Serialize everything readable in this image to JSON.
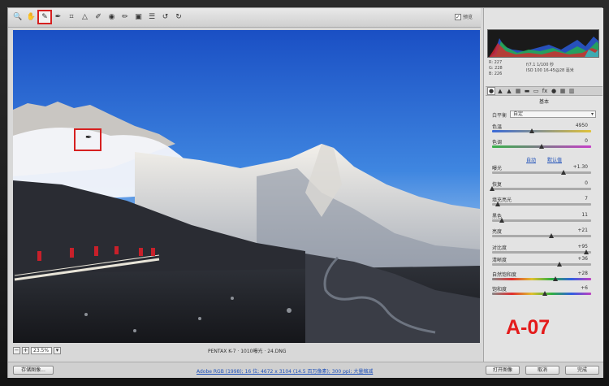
{
  "toolbar": {
    "tools": [
      {
        "name": "zoom-icon",
        "glyph": "🔍"
      },
      {
        "name": "hand-icon",
        "glyph": "✋"
      },
      {
        "name": "white-balance-icon",
        "glyph": "✎",
        "active": true
      },
      {
        "name": "color-sampler-icon",
        "glyph": "✒"
      },
      {
        "name": "crop-icon",
        "glyph": "⌗"
      },
      {
        "name": "straighten-icon",
        "glyph": "△"
      },
      {
        "name": "spot-removal-icon",
        "glyph": "✐"
      },
      {
        "name": "red-eye-icon",
        "glyph": "◉"
      },
      {
        "name": "adjustment-brush-icon",
        "glyph": "✏"
      },
      {
        "name": "graduated-filter-icon",
        "glyph": "▣"
      },
      {
        "name": "preferences-icon",
        "glyph": "☰"
      },
      {
        "name": "rotate-left-icon",
        "glyph": "↺"
      },
      {
        "name": "rotate-right-icon",
        "glyph": "↻"
      }
    ],
    "preview_label": "预览",
    "preview_checked": true
  },
  "image_status": {
    "zoom_value": "23.5%",
    "info": "PENTAX K-7  ·  1010曝光 · 24.DNG"
  },
  "bottom_bar": {
    "save_button": "存储图像...",
    "workflow_link": "Adobe RGB (1998); 16 位; 4672 x 3104 (14.5 百万像素); 300 ppi; 大量缩减",
    "open_button": "打开图像",
    "cancel_button": "取消",
    "done_button": "完成"
  },
  "histogram": {
    "rgb": {
      "r": "R: 227",
      "g": "G: 228",
      "b": "B: 226"
    },
    "camera": {
      "line1": "f/7.1  1/100 秒",
      "line2": "ISO 100  16-45@28 毫米"
    }
  },
  "panel": {
    "tab_icons": [
      "basic-tab-icon",
      "tone-curve-tab-icon",
      "detail-tab-icon",
      "hsl-tab-icon",
      "split-toning-tab-icon",
      "lens-tab-icon",
      "fx-tab-icon",
      "camera-calibration-tab-icon",
      "presets-tab-icon",
      "snapshots-tab-icon"
    ],
    "section_title": "基本",
    "white_balance_label": "白平衡",
    "white_balance_value": "自定",
    "auto_label": "自动",
    "default_label": "默认值",
    "sliders_top": [
      {
        "name": "temperature",
        "label": "色温",
        "value": "4950",
        "pos": 0.4
      },
      {
        "name": "tint",
        "label": "色调",
        "value": "0",
        "pos": 0.5
      }
    ],
    "sliders_tone": [
      {
        "name": "exposure",
        "label": "曝光",
        "value": "+1.30",
        "pos": 0.72
      },
      {
        "name": "recovery",
        "label": "恢复",
        "value": "0",
        "pos": 0.0
      },
      {
        "name": "fill-light",
        "label": "填充亮光",
        "value": "7",
        "pos": 0.06
      },
      {
        "name": "blacks",
        "label": "黑色",
        "value": "11",
        "pos": 0.1
      },
      {
        "name": "brightness",
        "label": "亮度",
        "value": "+21",
        "pos": 0.6
      },
      {
        "name": "contrast",
        "label": "对比度",
        "value": "+95",
        "pos": 0.95
      }
    ],
    "sliders_presence": [
      {
        "name": "clarity",
        "label": "清晰度",
        "value": "+36",
        "pos": 0.68
      },
      {
        "name": "vibrance",
        "label": "自然饱和度",
        "value": "+28",
        "pos": 0.64
      },
      {
        "name": "saturation",
        "label": "饱和度",
        "value": "+6",
        "pos": 0.53
      }
    ]
  },
  "overlay_label": "A-07"
}
